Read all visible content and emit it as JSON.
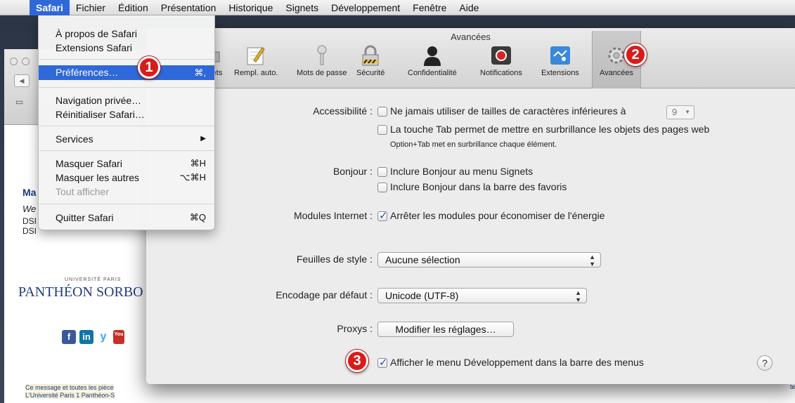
{
  "menubar": {
    "items": [
      "Safari",
      "Fichier",
      "Édition",
      "Présentation",
      "Historique",
      "Signets",
      "Développement",
      "Fenêtre",
      "Aide"
    ]
  },
  "safari_menu": {
    "about": "À propos de Safari",
    "extensions": "Extensions Safari",
    "preferences": "Préférences…",
    "preferences_shortcut": "⌘,",
    "private": "Navigation privée…",
    "reset": "Réinitialiser Safari…",
    "services": "Services",
    "services_arrow": "▶",
    "hide": "Masquer Safari",
    "hide_shortcut": "⌘H",
    "hide_others": "Masquer les autres",
    "hide_others_shortcut": "⌥⌘H",
    "show_all": "Tout afficher",
    "quit": "Quitter Safari",
    "quit_shortcut": "⌘Q"
  },
  "background": {
    "name": "Ma",
    "we": "We",
    "dsi1": "DSI",
    "dsi2": "DSI",
    "univ": "UNIVERSITÉ PARIS",
    "pantheon": "PANTHÉON SORBO",
    "msg1": "Ce message et toutes les pièce",
    "msg2": "L'Université Paris 1 Panthéon-S",
    "te": "te",
    "social": [
      "f",
      "in",
      "y",
      "You"
    ]
  },
  "prefs": {
    "title": "Avancées",
    "toolbar": [
      {
        "label": "ets",
        "icon": "tabs-icon"
      },
      {
        "label": "Rempl. auto.",
        "icon": "autofill-pencil-icon"
      },
      {
        "label": "Mots de passe",
        "icon": "key-icon"
      },
      {
        "label": "Sécurité",
        "icon": "padlock-icon"
      },
      {
        "label": "Confidentialité",
        "icon": "person-silhouette-icon"
      },
      {
        "label": "Notifications",
        "icon": "notifications-red-dot-icon"
      },
      {
        "label": "Extensions",
        "icon": "puzzle-icon"
      },
      {
        "label": "Avancées",
        "icon": "gear-icon"
      }
    ],
    "accessibility_label": "Accessibilité :",
    "accessibility_min_font": "Ne jamais utiliser de tailles de caractères inférieures à",
    "min_font_value": "9",
    "accessibility_tab": "La touche Tab permet de mettre en surbrillance les objets des pages web",
    "accessibility_tab_note": "Option+Tab met en surbrillance chaque élément.",
    "bonjour_label": "Bonjour :",
    "bonjour_signets": "Inclure Bonjour au menu Signets",
    "bonjour_favoris": "Inclure Bonjour dans la barre des favoris",
    "modules_label": "Modules Internet :",
    "modules_energy": "Arrêter les modules pour économiser de l'énergie",
    "stylesheet_label": "Feuilles de style :",
    "stylesheet_value": "Aucune sélection",
    "encoding_label": "Encodage par défaut :",
    "encoding_value": "Unicode (UTF-8)",
    "proxys_label": "Proxys :",
    "proxys_button": "Modifier les réglages…",
    "develop_menu": "Afficher le menu Développement dans la barre des menus",
    "help": "?"
  },
  "annotations": [
    "1",
    "2",
    "3"
  ],
  "colors": {
    "menu_highlight": "#2e68d9",
    "badge_red": "#d81c1c",
    "checkbox_check": "#1e56b8"
  }
}
